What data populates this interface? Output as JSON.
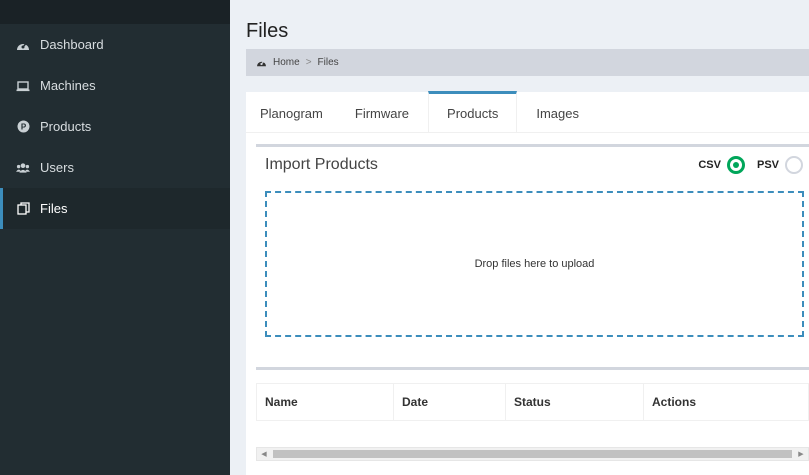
{
  "sidebar": {
    "items": [
      {
        "label": "Dashboard",
        "icon": "dashboard-icon"
      },
      {
        "label": "Machines",
        "icon": "laptop-icon"
      },
      {
        "label": "Products",
        "icon": "product-badge-icon"
      },
      {
        "label": "Users",
        "icon": "users-icon"
      },
      {
        "label": "Files",
        "icon": "files-icon"
      }
    ],
    "active": "Files"
  },
  "page": {
    "title": "Files"
  },
  "breadcrumb": {
    "home": "Home",
    "separator": ">",
    "current": "Files"
  },
  "tabs": [
    {
      "label": "Planogram"
    },
    {
      "label": "Firmware"
    },
    {
      "label": "Products"
    },
    {
      "label": "Images"
    }
  ],
  "active_tab": "Products",
  "import_panel": {
    "title": "Import Products",
    "options": [
      {
        "label": "CSV",
        "selected": true
      },
      {
        "label": "PSV",
        "selected": false
      }
    ],
    "dropzone_text": "Drop files here to upload"
  },
  "table": {
    "columns": [
      "Name",
      "Date",
      "Status",
      "Actions"
    ]
  },
  "colors": {
    "sidebar_bg": "#222d32",
    "accent": "#3c8dbc",
    "selected_radio": "#00a65a",
    "content_bg": "#ecf0f5"
  }
}
